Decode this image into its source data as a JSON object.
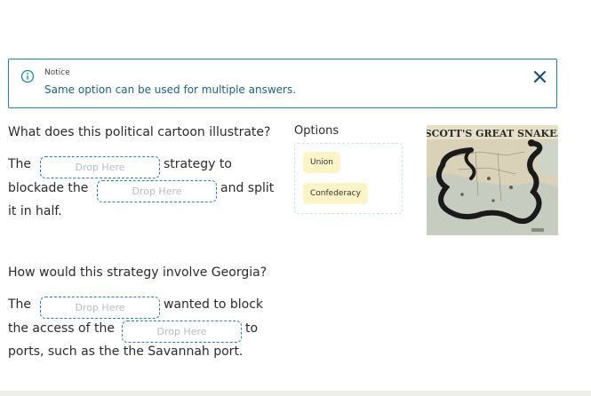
{
  "notice": {
    "title": "Notice",
    "message": "Same option can be used for multiple answers.",
    "accent_color": "#1b87a8"
  },
  "question1": {
    "prompt": "What does this political cartoon illustrate?",
    "text_the": "The",
    "text_strategy_to": "strategy to",
    "text_blockade_the": "blockade the",
    "text_and_split": "and split",
    "text_it_in_half": "it in half."
  },
  "question2": {
    "prompt": "How would this strategy involve Georgia?",
    "text_the": "The",
    "text_wanted_to_block": "wanted to block",
    "text_the_access_of_the": "the access of the",
    "text_to": "to",
    "text_ports": "ports, such as the the Savannah port."
  },
  "drop_placeholder": "Drop Here",
  "options": {
    "title": "Options",
    "items": [
      "Union",
      "Confederacy"
    ],
    "chip_color": "#fbf4c7"
  },
  "cartoon": {
    "caption": "SCOTT'S GREAT SNAKE."
  }
}
